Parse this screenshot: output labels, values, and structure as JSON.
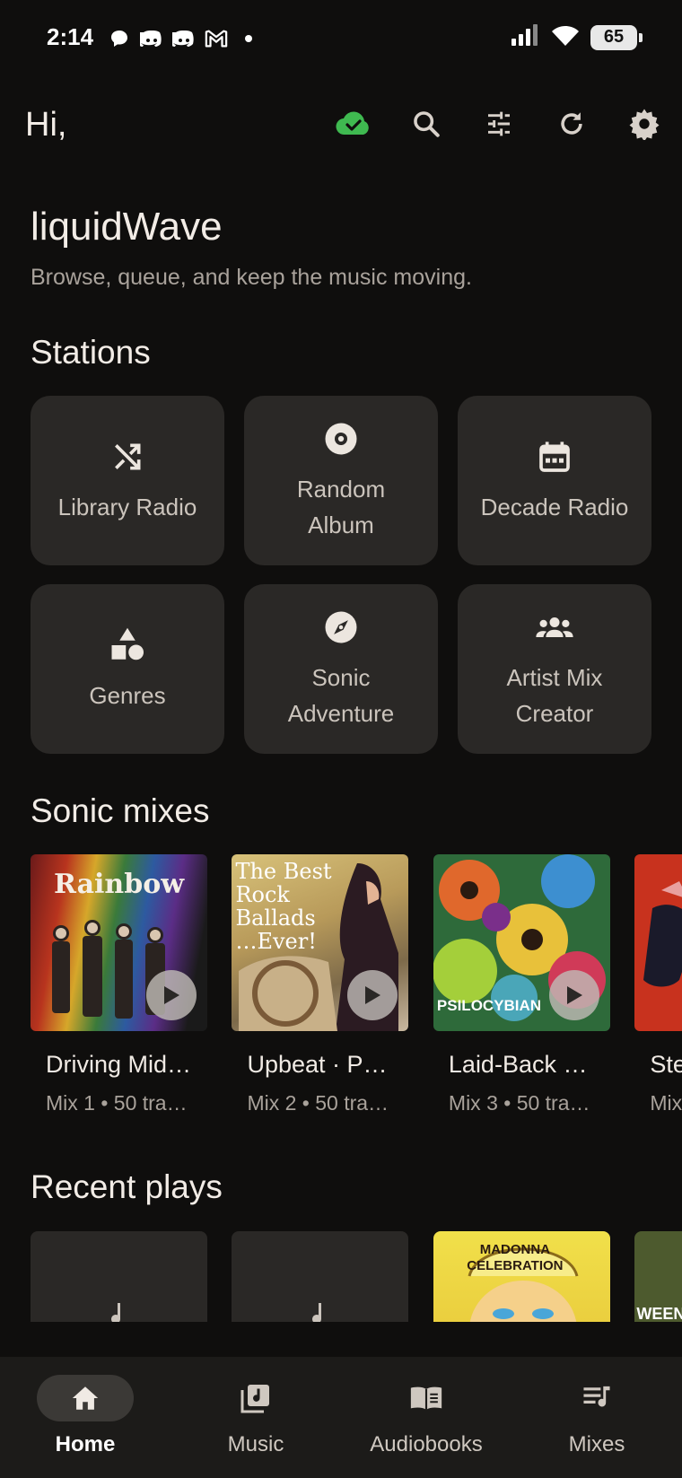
{
  "status_bar": {
    "time": "2:14",
    "battery": "65",
    "notification_icons": [
      "chat-bubble-icon",
      "discord-icon",
      "discord-icon",
      "gmail-icon",
      "dot-icon"
    ]
  },
  "header": {
    "greeting": "Hi,",
    "icons": [
      "cloud-synced-icon",
      "search-icon",
      "tune-icon",
      "refresh-icon",
      "settings-icon"
    ],
    "sync_color": "#3fb950"
  },
  "app": {
    "title": "liquidWave",
    "subtitle": "Browse, queue, and keep the music moving."
  },
  "stations": {
    "title": "Stations",
    "items": [
      {
        "label": "Library Radio",
        "icon": "shuffle-icon"
      },
      {
        "label": "Random Album",
        "icon": "disc-icon"
      },
      {
        "label": "Decade Radio",
        "icon": "calendar-icon"
      },
      {
        "label": "Genres",
        "icon": "shapes-icon"
      },
      {
        "label": "Sonic Adventure",
        "icon": "compass-icon"
      },
      {
        "label": "Artist Mix Creator",
        "icon": "group-icon"
      }
    ]
  },
  "sonic_mixes": {
    "title": "Sonic mixes",
    "items": [
      {
        "title": "Driving Mid…",
        "subtitle": "Mix 1 • 50 tra…",
        "cover_text": "Rainbow"
      },
      {
        "title": "Upbeat · P…",
        "subtitle": "Mix 2 • 50 tra…",
        "cover_text": "The Best Rock Ballads …Ever!"
      },
      {
        "title": "Laid-Back …",
        "subtitle": "Mix 3 • 50 tra…",
        "cover_text": "PSILOCYBIAN"
      },
      {
        "title": "Stea",
        "subtitle": "Mix",
        "cover_text": ""
      }
    ]
  },
  "recent_plays": {
    "title": "Recent plays",
    "items": [
      {
        "cover_text": ""
      },
      {
        "cover_text": ""
      },
      {
        "cover_text": "MADONNA CELEBRATION"
      },
      {
        "cover_text": "WEEN"
      }
    ]
  },
  "bottom_nav": {
    "items": [
      {
        "label": "Home",
        "icon": "home-icon",
        "active": true
      },
      {
        "label": "Music",
        "icon": "music-library-icon",
        "active": false
      },
      {
        "label": "Audiobooks",
        "icon": "book-icon",
        "active": false
      },
      {
        "label": "Mixes",
        "icon": "queue-music-icon",
        "active": false
      }
    ]
  }
}
